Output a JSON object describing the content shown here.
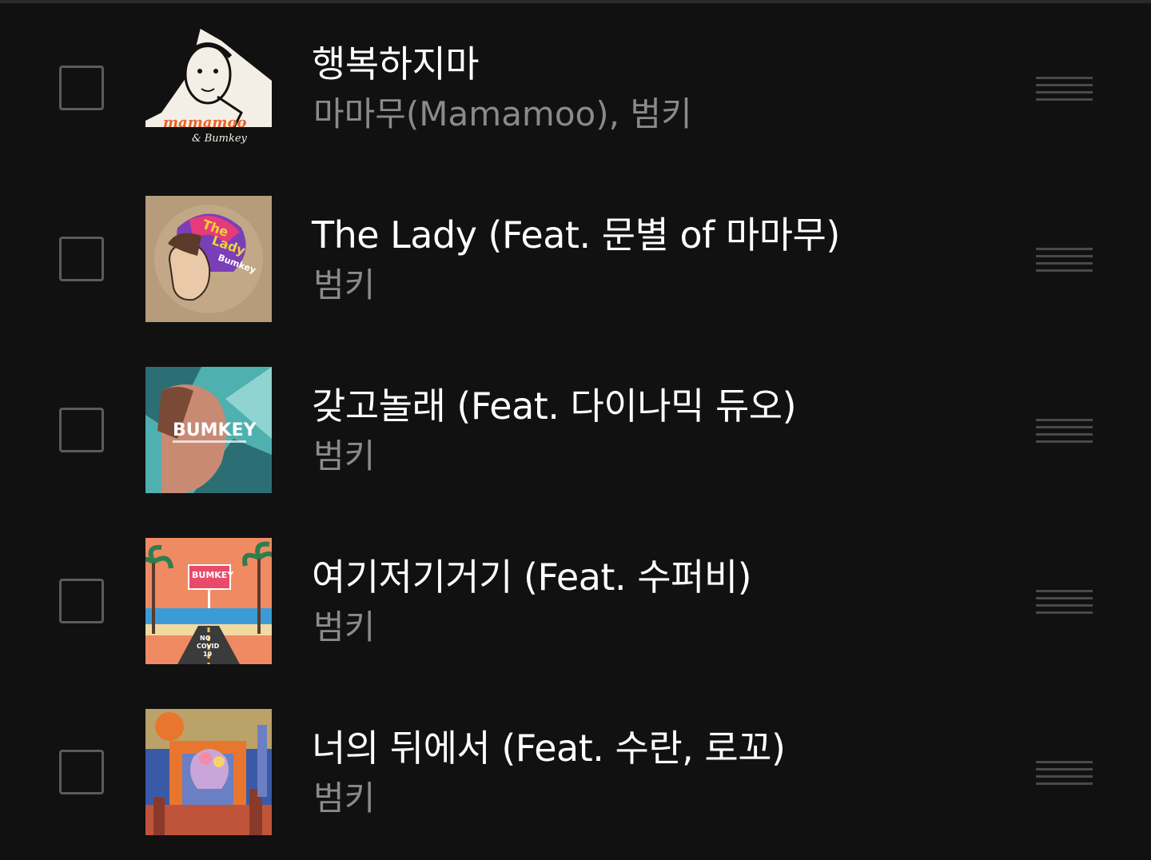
{
  "tracks": [
    {
      "title": "행복하지마",
      "artist": "마마무(Mamamoo), 범키",
      "cover": {
        "icon": "album-cover-happy-dont",
        "art_text": [
          "mamamoo",
          "& Bumkey"
        ],
        "colors": [
          "#f4efe6",
          "#111111",
          "#e8642a"
        ]
      }
    },
    {
      "title": "The Lady (Feat. 문별 of 마마무)",
      "artist": "범키",
      "cover": {
        "icon": "album-cover-the-lady",
        "art_text": [
          "The",
          "Lady",
          "Bumkey"
        ],
        "colors": [
          "#b79c7c",
          "#7a3fb8",
          "#e63b7a"
        ]
      }
    },
    {
      "title": "갖고놀래 (Feat. 다이나믹 듀오)",
      "artist": "범키",
      "cover": {
        "icon": "album-cover-bumkey-teal",
        "art_text": [
          "BUMKEY"
        ],
        "colors": [
          "#4fb0b0",
          "#c98a74",
          "#2b6e73"
        ]
      }
    },
    {
      "title": "여기저기거기 (Feat. 수퍼비)",
      "artist": "범키",
      "cover": {
        "icon": "album-cover-bumkey-beach",
        "art_text": [
          "BUMKEY",
          "NO",
          "COVID",
          "19"
        ],
        "colors": [
          "#f08a62",
          "#2e7d4f",
          "#3a9bd6"
        ]
      }
    },
    {
      "title": "너의 뒤에서 (Feat. 수란, 로꼬)",
      "artist": "범키",
      "cover": {
        "icon": "album-cover-lalala",
        "art_text": [],
        "colors": [
          "#e8762f",
          "#3a5aa8",
          "#f2c14e"
        ]
      }
    }
  ]
}
